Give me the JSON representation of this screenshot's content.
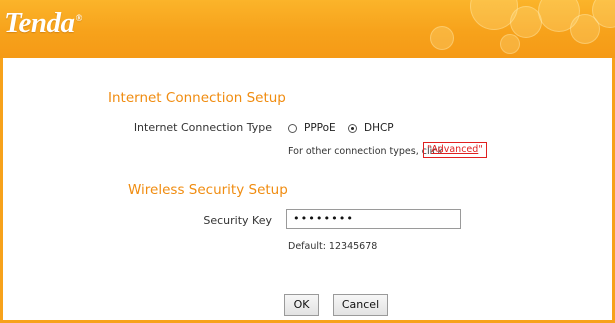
{
  "brand": {
    "logo_text": "Tenda",
    "registered_mark": "®"
  },
  "internet": {
    "section_title": "Internet Connection Setup",
    "type_label": "Internet Connection Type",
    "options": [
      "PPPoE",
      "DHCP"
    ],
    "selected": "DHCP",
    "other_types_text": "For other connection types, click",
    "advanced_link": "Advanced"
  },
  "wireless": {
    "section_title": "Wireless Security Setup",
    "key_label": "Security Key",
    "key_value": "••••••••",
    "default_text": "Default: 12345678"
  },
  "buttons": {
    "ok": "OK",
    "cancel": "Cancel"
  },
  "colors": {
    "brand_orange": "#f7a21b",
    "title_orange": "#f08c10",
    "highlight_red": "#e02020"
  }
}
